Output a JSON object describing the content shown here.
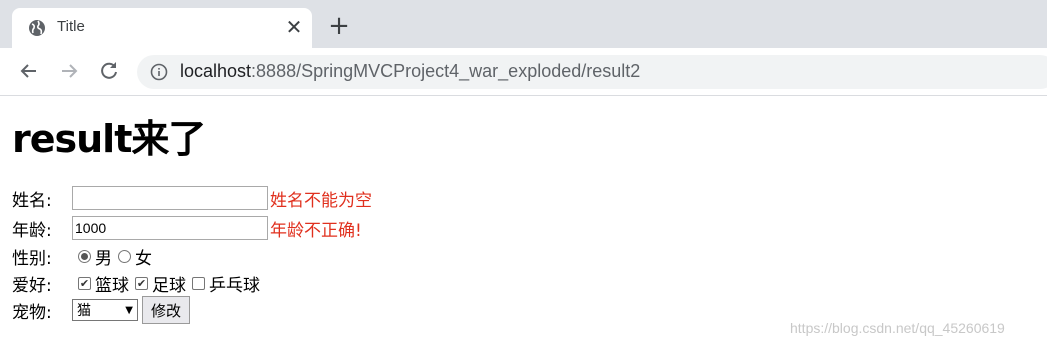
{
  "browser": {
    "tab_title": "Title",
    "tab_close": "✕",
    "new_tab": "+",
    "url_host": "localhost",
    "url_path": ":8888/SpringMVCProject4_war_exploded/result2"
  },
  "page": {
    "title": "result来了",
    "form": {
      "name_label": "姓名:",
      "name_value": "",
      "name_error": "姓名不能为空",
      "age_label": "年龄:",
      "age_value": "1000",
      "age_error": "年龄不正确!",
      "gender_label": "性别:",
      "gender_options": [
        "男",
        "女"
      ],
      "gender_selected": "男",
      "hobby_label": "爱好:",
      "hobbies": [
        {
          "label": "篮球",
          "checked": true
        },
        {
          "label": "足球",
          "checked": true
        },
        {
          "label": "乒乓球",
          "checked": false
        }
      ],
      "pet_label": "宠物:",
      "pet_selected": "猫",
      "submit_label": "修改"
    },
    "watermark": "https://blog.csdn.net/qq_45260619"
  },
  "colors": {
    "error": "#e0301e",
    "tabbar": "#dee1e6"
  }
}
